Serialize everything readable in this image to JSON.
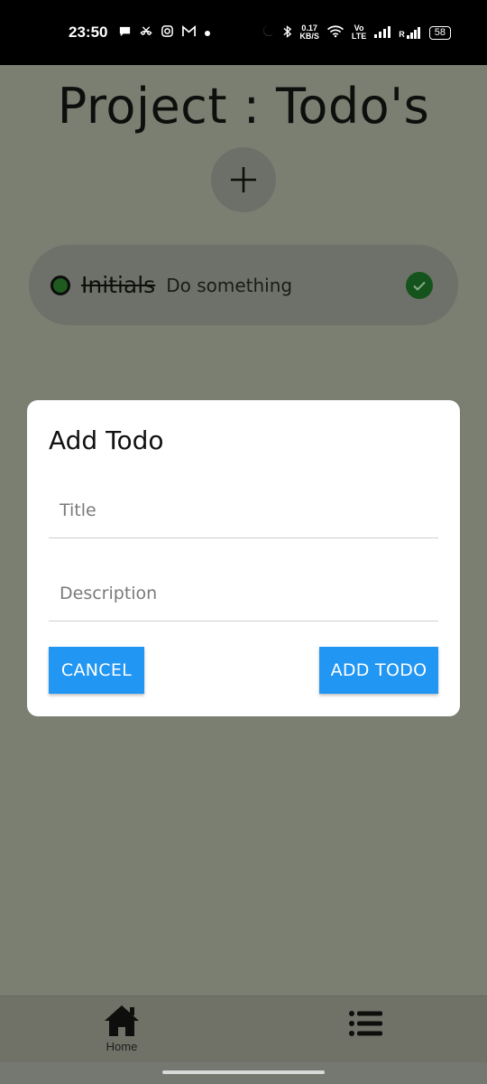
{
  "status_bar": {
    "time": "23:50",
    "net_speed_value": "0.17",
    "net_speed_unit": "KB/S",
    "volte_top": "Vo",
    "volte_bottom": "LTE",
    "roaming": "R",
    "battery": "58"
  },
  "page": {
    "title": "Project  : Todo's"
  },
  "todo_list": [
    {
      "title": "Initials",
      "description": "Do something",
      "completed": true
    }
  ],
  "dialog": {
    "title": "Add Todo",
    "title_placeholder": "Title",
    "description_placeholder": "Description",
    "cancel_label": "CANCEL",
    "add_label": "ADD TODO"
  },
  "bottom_nav": {
    "home_label": "Home"
  },
  "colors": {
    "primary_button": "#2196f3",
    "check_green": "#14541c",
    "scrim": "#7a7f72"
  }
}
